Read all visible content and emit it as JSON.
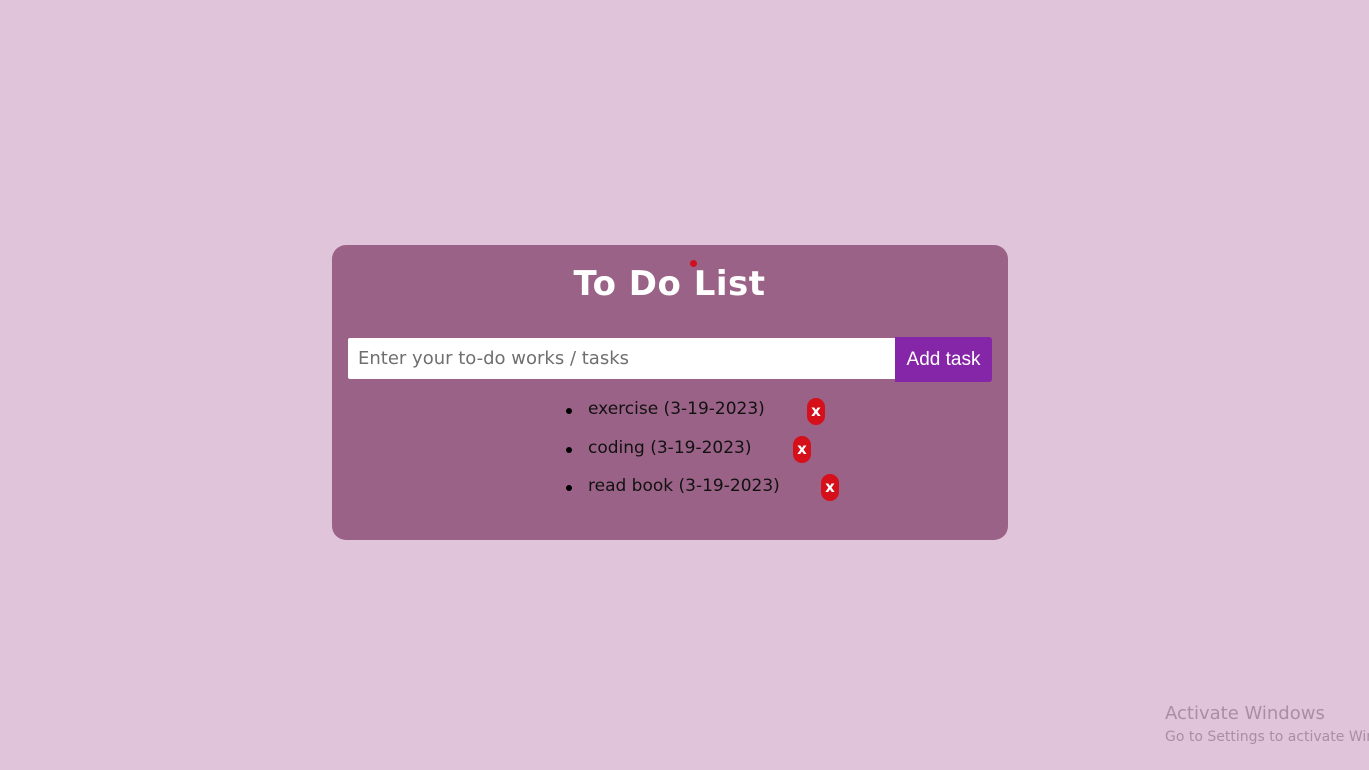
{
  "app": {
    "title": "To Do List"
  },
  "input": {
    "value": "",
    "placeholder": "Enter your to-do works / tasks"
  },
  "add_button": {
    "label": "Add task"
  },
  "tasks": [
    {
      "text": "exercise (3-19-2023)",
      "delete_label": "x"
    },
    {
      "text": "coding (3-19-2023)",
      "delete_label": "x"
    },
    {
      "text": "read book (3-19-2023)",
      "delete_label": "x"
    }
  ],
  "watermark": {
    "title": "Activate Windows",
    "subtitle": "Go to Settings to activate Windows."
  },
  "colors": {
    "page_background": "#e0c4da",
    "card_background": "#9a6286",
    "add_button": "#8526a8",
    "delete_button": "#d6101a",
    "title_text": "#ffffff"
  }
}
